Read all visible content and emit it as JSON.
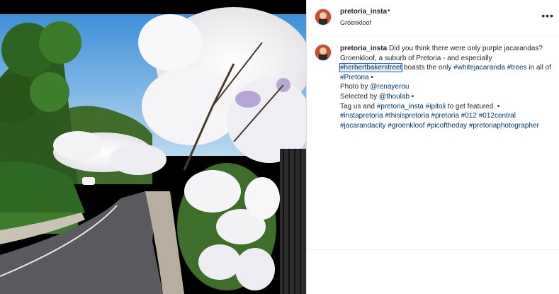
{
  "post": {
    "username": "pretoria_insta",
    "follow_dot": "•",
    "location": "Groenkloof",
    "more_icon": "more-horizontal-icon"
  },
  "caption": {
    "username": "pretoria_insta",
    "line1": "Did you think there were only purple jacarandas?",
    "line2": "Groenkloof, a suburb of Pretoria - and especially",
    "tag_herbertbakerstreet": "#herbertbakerstreet",
    "line3_after": " boasts the only ",
    "tag_whitejacaranda": "#whitejacaranda",
    "tag_trees": "#trees",
    "line3_end": " in all of ",
    "tag_pretoria_1": "#Pretoria",
    "line3_dot": " •",
    "photo_by": "Photo by ",
    "mention_renayerou": "@renayerou",
    "selected_by": "Selected by ",
    "mention_thoulab": "@thoulab",
    "selected_dot": " •",
    "tag_us": "Tag us and ",
    "tag_pretoria_insta": "#pretoria_insta",
    "tag_ipitoli": "#ipitoli",
    "featured": " to get featured. •",
    "hashtags": [
      "#instapretoria",
      "#thisispretoria",
      "#pretoria",
      "#012",
      "#012central",
      "#jacarandacity",
      "#groenkloof",
      "#picoftheday",
      "#pretoriaphotographer"
    ]
  },
  "colors": {
    "link": "#00376b",
    "text": "#262626",
    "border": "#dbdbdb"
  }
}
